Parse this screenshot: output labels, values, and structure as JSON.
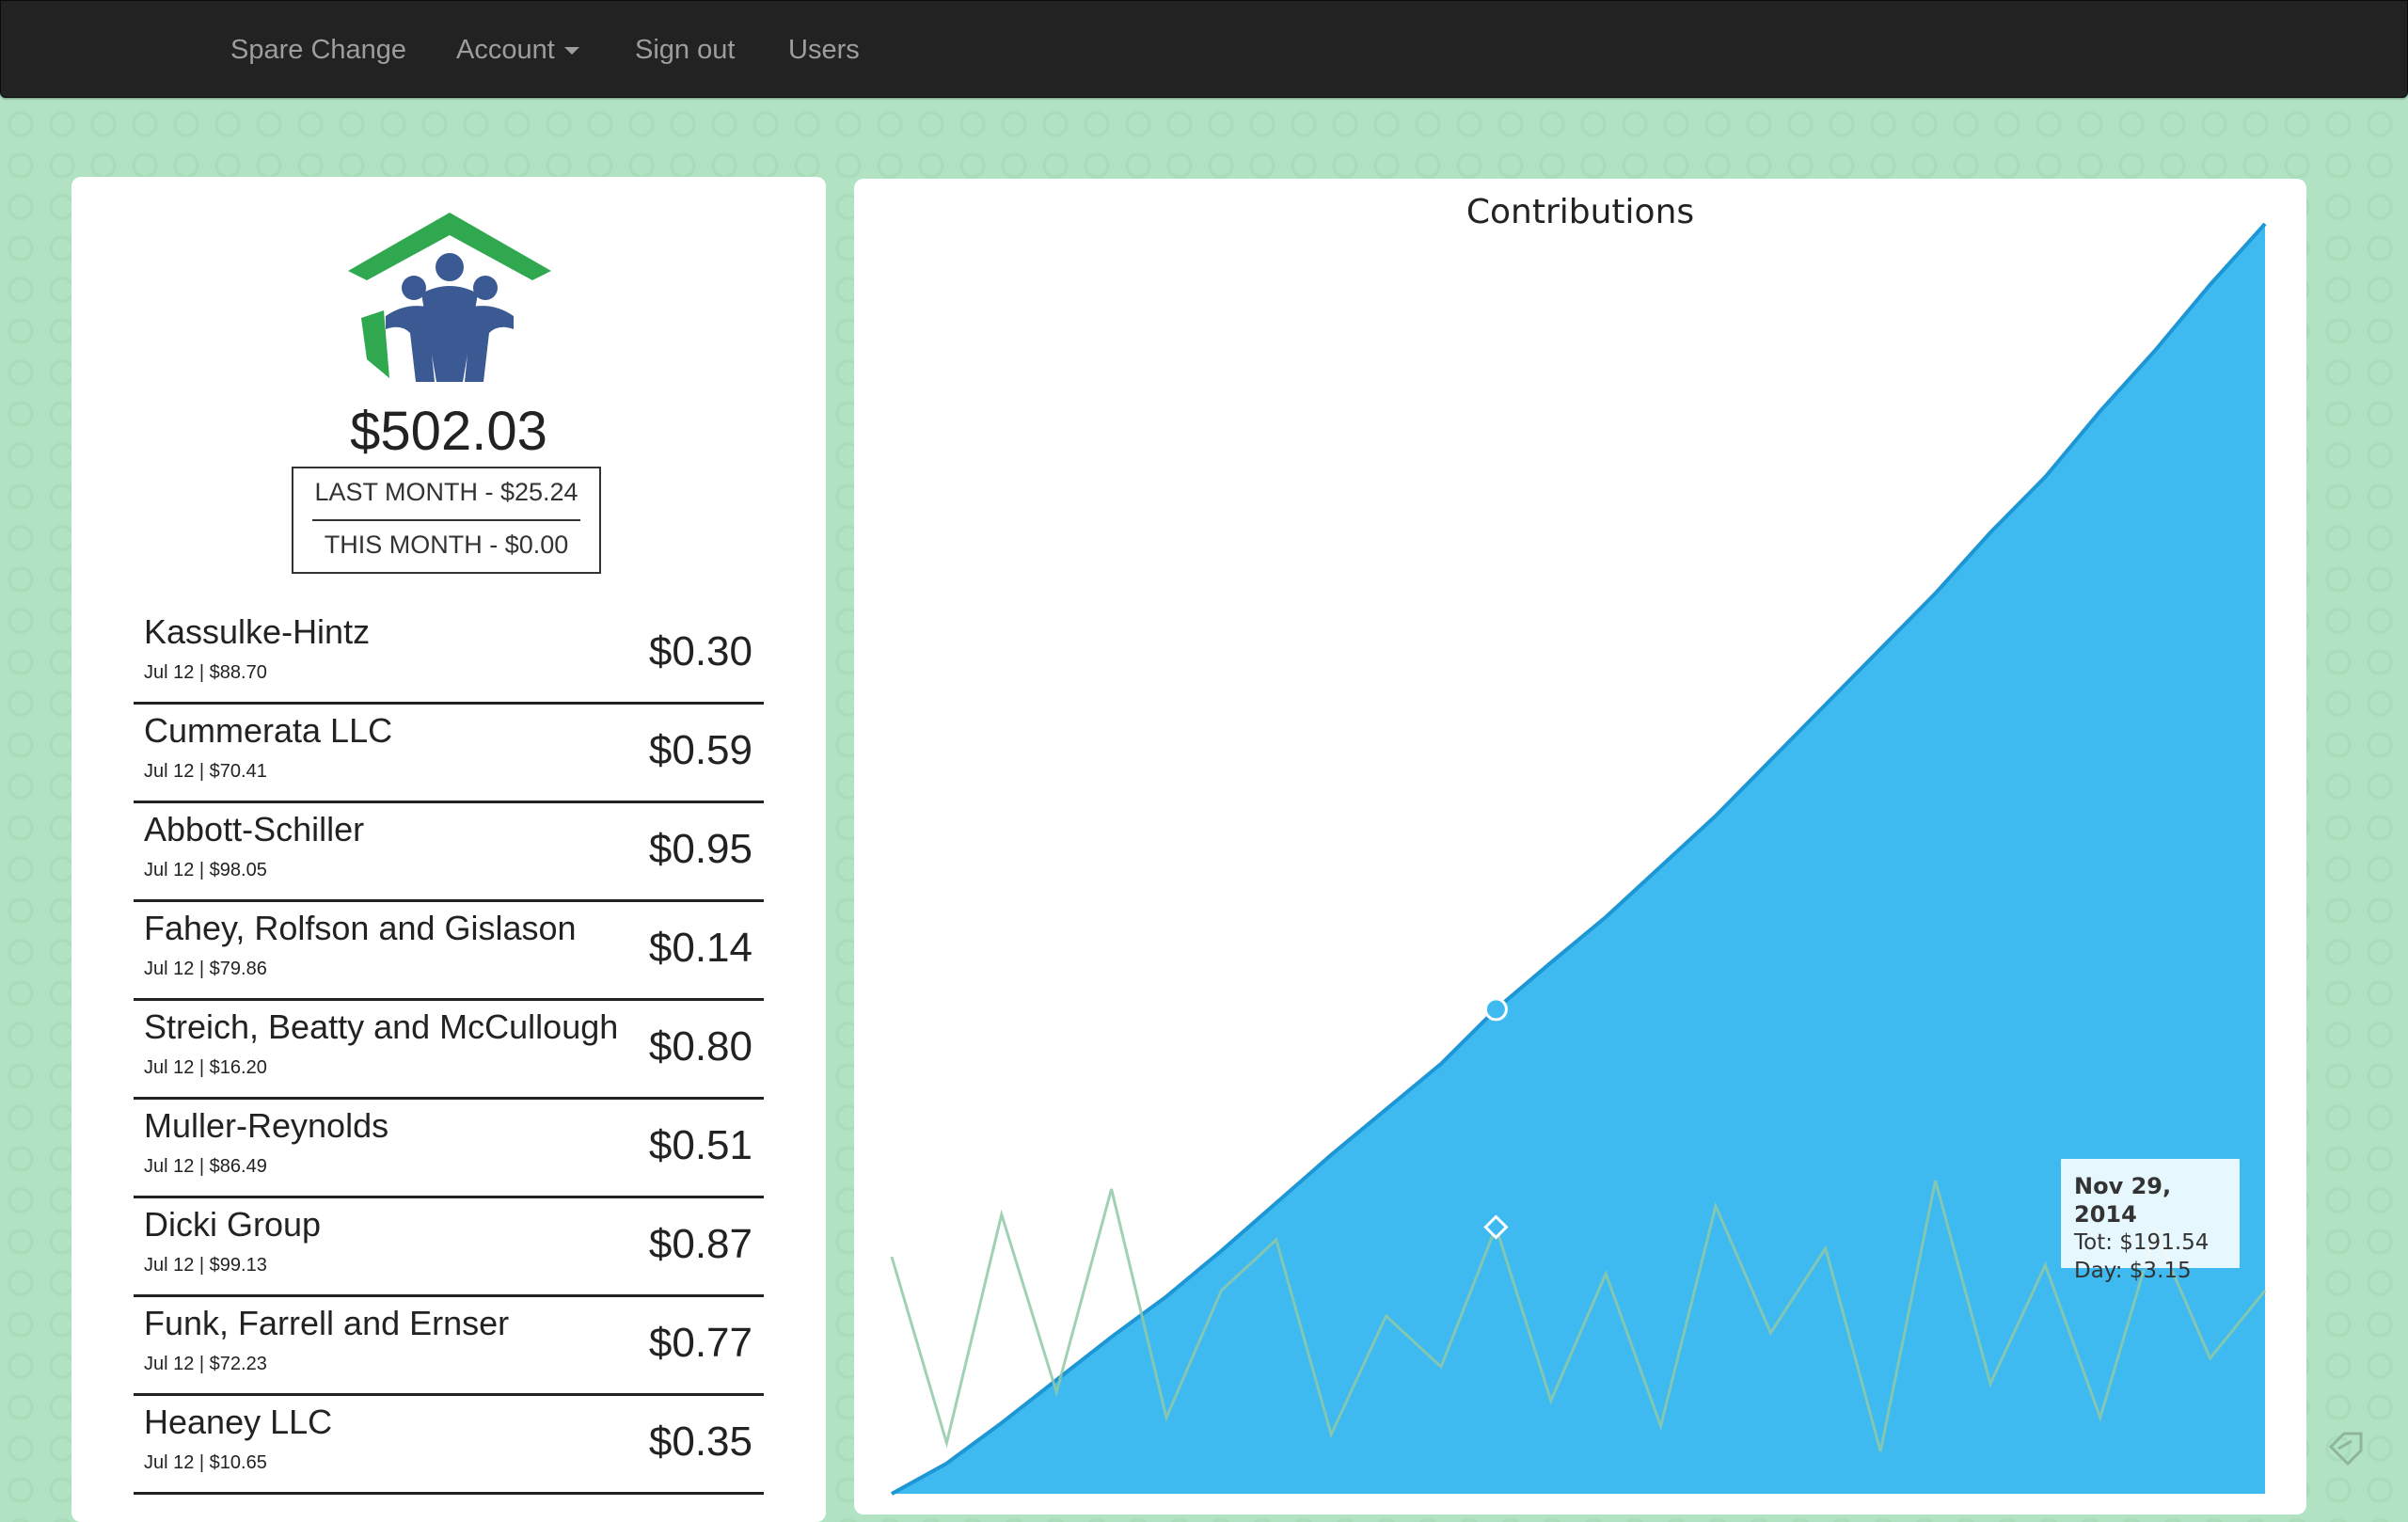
{
  "nav": {
    "brand": "Spare Change",
    "account": "Account",
    "signout": "Sign out",
    "users": "Users"
  },
  "summary": {
    "total": "$502.03",
    "last_month": "LAST MONTH - $25.24",
    "this_month": "THIS MONTH - $0.00"
  },
  "transactions": [
    {
      "name": "Kassulke-Hintz",
      "sub": "Jul 12 | $88.70",
      "amount": "$0.30"
    },
    {
      "name": "Cummerata LLC",
      "sub": "Jul 12 | $70.41",
      "amount": "$0.59"
    },
    {
      "name": "Abbott-Schiller",
      "sub": "Jul 12 | $98.05",
      "amount": "$0.95"
    },
    {
      "name": "Fahey, Rolfson and Gislason",
      "sub": "Jul 12 | $79.86",
      "amount": "$0.14"
    },
    {
      "name": "Streich, Beatty and McCullough",
      "sub": "Jul 12 | $16.20",
      "amount": "$0.80"
    },
    {
      "name": "Muller-Reynolds",
      "sub": "Jul 12 | $86.49",
      "amount": "$0.51"
    },
    {
      "name": "Dicki Group",
      "sub": "Jul 12 | $99.13",
      "amount": "$0.87"
    },
    {
      "name": "Funk, Farrell and Ernser",
      "sub": "Jul 12 | $72.23",
      "amount": "$0.77"
    },
    {
      "name": "Heaney LLC",
      "sub": "Jul 12 | $10.65",
      "amount": "$0.35"
    }
  ],
  "colors": {
    "area_fill": "#3ebaf0",
    "area_line": "#1d96d6",
    "daily_line": "#8fc9a8"
  },
  "chart_data": {
    "type": "area",
    "title": "Contributions",
    "series": [
      {
        "name": "Tot",
        "values": [
          0,
          12,
          28,
          45,
          62,
          78,
          96,
          115,
          134,
          152,
          170,
          191.54,
          210,
          228,
          248,
          268,
          290,
          312,
          334,
          356,
          380,
          402,
          428,
          452,
          478,
          502.03
        ]
      },
      {
        "name": "Day",
        "values": [
          2.8,
          0.6,
          3.3,
          1.2,
          3.6,
          0.9,
          2.4,
          3.0,
          0.7,
          2.1,
          1.5,
          3.15,
          1.1,
          2.6,
          0.8,
          3.4,
          1.9,
          2.9,
          0.5,
          3.7,
          1.3,
          2.7,
          0.9,
          3.1,
          1.6,
          2.4
        ]
      }
    ],
    "tooltip": {
      "date": "Nov 29, 2014",
      "tot": "Tot: $191.54",
      "day": "Day: $3.15"
    },
    "highlight_index": 11
  }
}
